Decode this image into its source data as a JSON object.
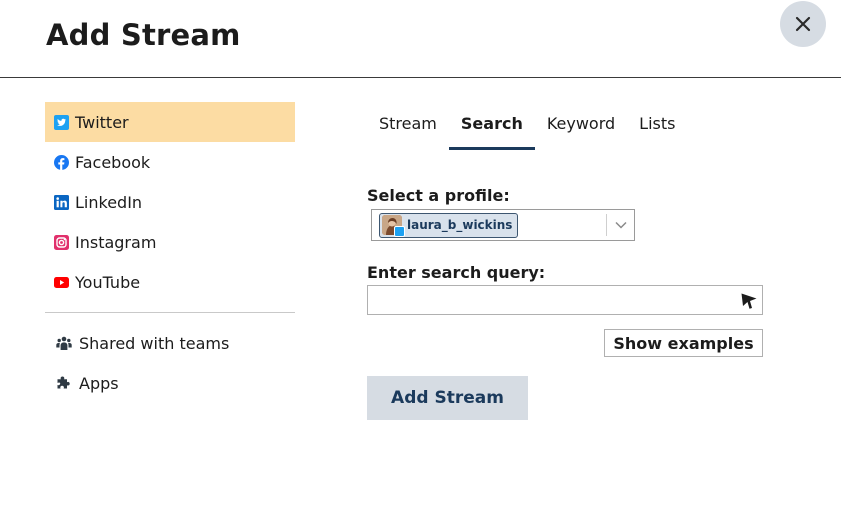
{
  "dialog": {
    "title": "Add Stream",
    "close_icon": "close-icon"
  },
  "sidebar": {
    "networks": [
      {
        "label": "Twitter",
        "icon": "twitter-icon",
        "active": true,
        "color": "#1da1f2"
      },
      {
        "label": "Facebook",
        "icon": "facebook-icon",
        "active": false,
        "color": "#1877f2"
      },
      {
        "label": "LinkedIn",
        "icon": "linkedin-icon",
        "active": false,
        "color": "#0a66c2"
      },
      {
        "label": "Instagram",
        "icon": "instagram-icon",
        "active": false,
        "color": "#e1306c"
      },
      {
        "label": "YouTube",
        "icon": "youtube-icon",
        "active": false,
        "color": "#ff0000"
      }
    ],
    "extras": [
      {
        "label": "Shared with teams",
        "icon": "teams-icon"
      },
      {
        "label": "Apps",
        "icon": "puzzle-icon"
      }
    ]
  },
  "tabs": [
    {
      "label": "Stream",
      "active": false
    },
    {
      "label": "Search",
      "active": true
    },
    {
      "label": "Keyword",
      "active": false
    },
    {
      "label": "Lists",
      "active": false
    }
  ],
  "form": {
    "profile_label": "Select a profile:",
    "profile_value": "laura_b_wickins",
    "query_label": "Enter search query:",
    "query_value": "",
    "show_examples_label": "Show examples",
    "submit_label": "Add Stream"
  },
  "colors": {
    "active_sidebar_bg": "#fcdca3",
    "active_tab_underline": "#1b3a5c",
    "button_bg": "#d6dce3",
    "button_text": "#1b3a5c"
  }
}
